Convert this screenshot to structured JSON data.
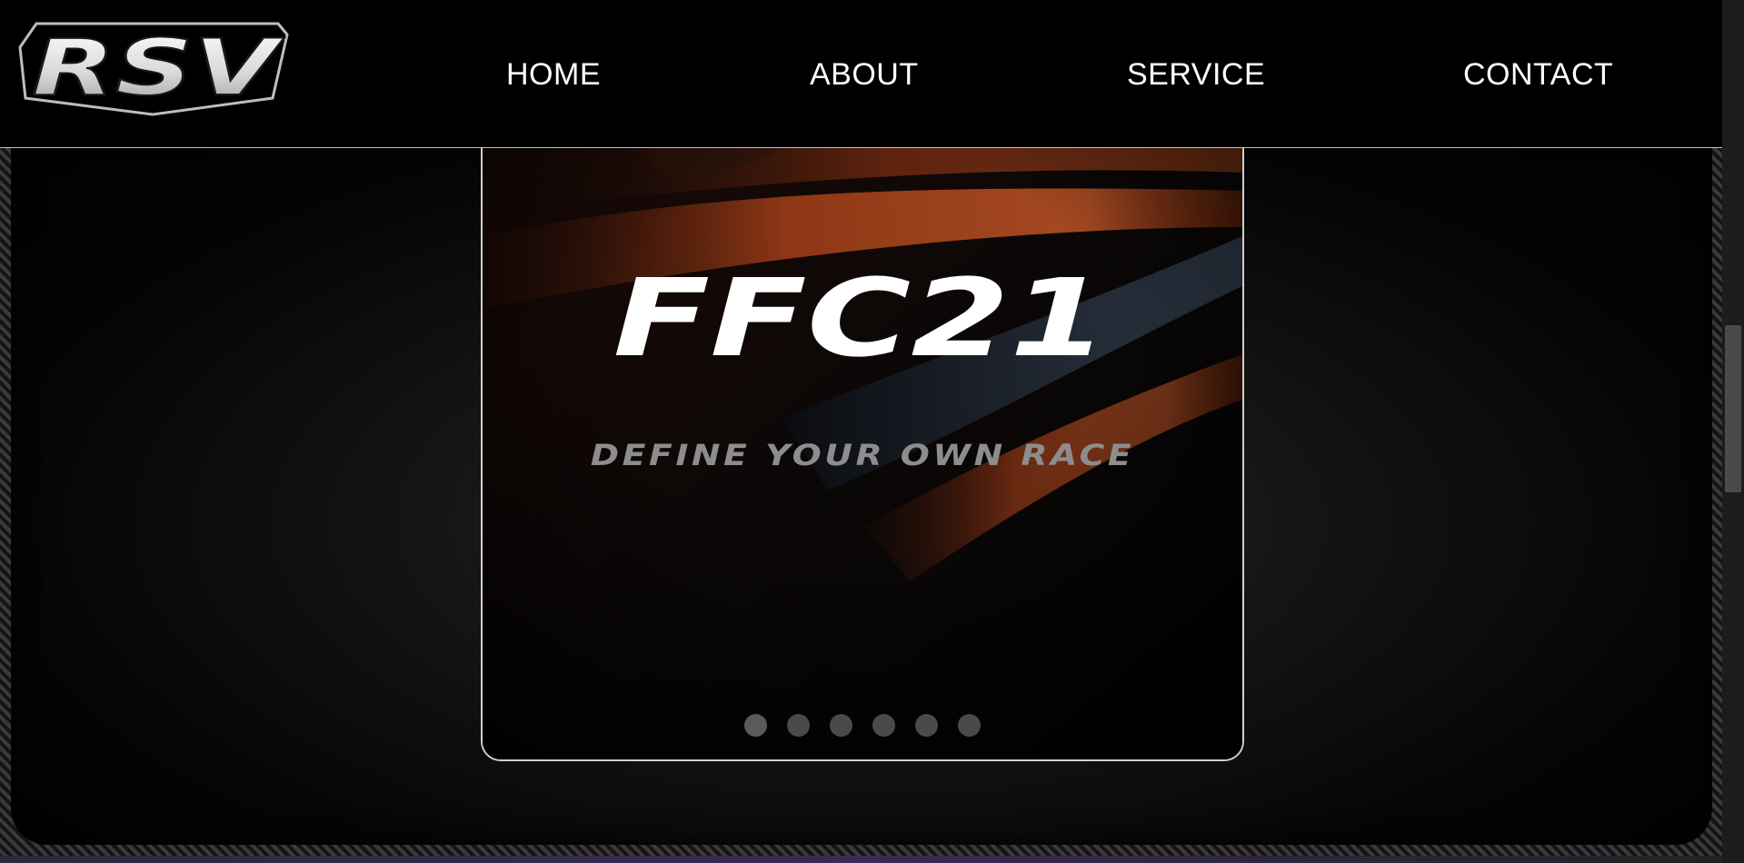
{
  "header": {
    "logo_text": "RSV",
    "nav": {
      "home": "HOME",
      "about": "ABOUT",
      "service": "SERVICE",
      "contact": "CONTACT"
    }
  },
  "slider": {
    "title": "FFC21",
    "tagline": "DEFINE YOUR OWN RACE",
    "dot_count": 6,
    "active_dot": 1
  },
  "colors": {
    "background": "#000000",
    "nav_text": "#ffffff",
    "accent_orange": "#c4511c",
    "tagline": "#8d8d8d",
    "dot": "#4a4a4a"
  }
}
